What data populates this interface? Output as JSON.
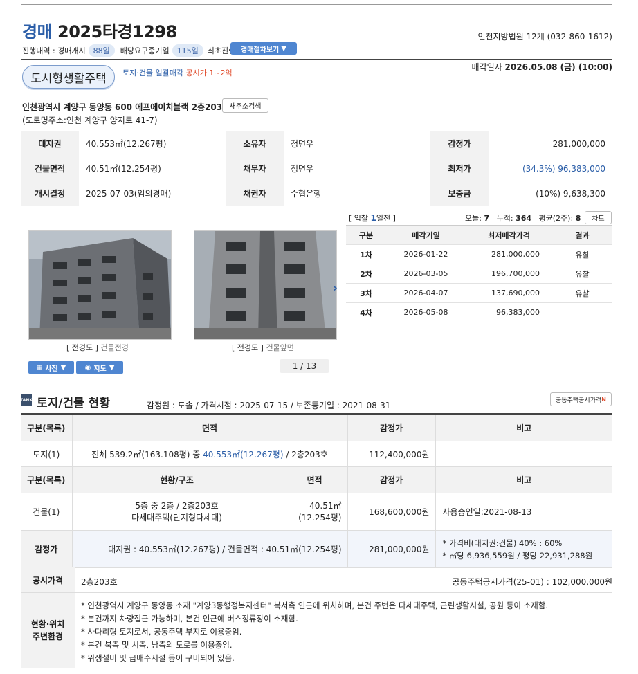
{
  "header": {
    "title_type": "경매",
    "case_no": "2025타경1298",
    "court": "인천지방법원 12계 (032-860-1612)",
    "progress_label": "진행내역 : 경매개시",
    "days_since_start": "88일",
    "dividend_label": "배당요구종기일",
    "dividend_days": "115일",
    "status": "최초진행",
    "procedure_button": "경매절차보기",
    "sale_date_label": "매각일자",
    "sale_date": "2026.05.08 (금) (10:00)"
  },
  "property": {
    "type": "도시형생활주택",
    "sale_kind": "토지·건물 일괄매각",
    "price_range": "공시가 1~2억",
    "address": "인천광역시 계양구 동양동 600 에프에이치블랙 2층203호",
    "new_address_button": "새주소검색",
    "road_address": "(도로명주소:인천 계양구 양지로 41-7)"
  },
  "summary": {
    "land_area_label": "대지권",
    "land_area": "40.553㎡(12.267평)",
    "owner_label": "소유자",
    "owner": "정면우",
    "appraisal_label": "감정가",
    "appraisal": "281,000,000",
    "building_area_label": "건물면적",
    "building_area": "40.51㎡(12.254평)",
    "debtor_label": "채무자",
    "debtor": "정면우",
    "min_price_label": "최저가",
    "min_price": "(34.3%) 96,383,000",
    "decision_label": "개시결정",
    "decision": "2025-07-03(임의경매)",
    "creditor_label": "채권자",
    "creditor": "수협은행",
    "deposit_label": "보증금",
    "deposit": "(10%) 9,638,300"
  },
  "photos": {
    "cap1_tag": "[ 전경도 ]",
    "cap1": "건물전경",
    "cap2_tag": "[ 전경도 ]",
    "cap2": "건물앞면",
    "photo_button": "사진",
    "map_button": "지도",
    "pager": "1 / 13"
  },
  "bids": {
    "head_prefix": "[ 입찰 ",
    "days": "1",
    "head_suffix": "일전 ]",
    "today_label": "오늘:",
    "today": "7",
    "total_label": "누적:",
    "total": "364",
    "avg_label": "평균(2주):",
    "avg": "8",
    "chart_button": "차트",
    "columns": [
      "구분",
      "매각기일",
      "최저매각가격",
      "결과"
    ],
    "rows": [
      {
        "round": "1차",
        "date": "2026-01-22",
        "price": "281,000,000",
        "result": "유찰"
      },
      {
        "round": "2차",
        "date": "2026-03-05",
        "price": "196,700,000",
        "result": "유찰"
      },
      {
        "round": "3차",
        "date": "2026-04-07",
        "price": "137,690,000",
        "result": "유찰"
      },
      {
        "round": "4차",
        "date": "2026-05-08",
        "price": "96,383,000",
        "result": ""
      }
    ]
  },
  "status_section": {
    "icon_text": "TANK",
    "title": "토지/건물 현황",
    "meta": "감정원 : 도솔 / 가격시점 : 2025-07-15 / 보존등기일 : 2021-08-31",
    "public_price_button": "공동주택공시가격",
    "new_mark": "N",
    "land_head": [
      "구분(목록)",
      "면적",
      "감정가",
      "비고"
    ],
    "land_row": {
      "kind": "토지(1)",
      "area_prefix": "전체 539.2㎡(163.108평) 중 ",
      "area_highlight": "40.553㎡(12.267평)",
      "area_suffix": " / 2층203호",
      "price": "112,400,000원",
      "note": ""
    },
    "bldg_head": [
      "구분(목록)",
      "현황/구조",
      "면적",
      "감정가",
      "비고"
    ],
    "bldg_row": {
      "kind": "건물(1)",
      "structure1": "5층 중 2층 / 2층203호",
      "structure2": "다세대주택(단지형다세대)",
      "area1": "40.51㎡",
      "area2": "(12.254평)",
      "price": "168,600,000원",
      "note": "사용승인일:2021-08-13"
    },
    "appraisal_row": {
      "label": "감정가",
      "areas": "대지권 : 40.553㎡(12.267평) / 건물면적 : 40.51㎡(12.254평)",
      "price": "281,000,000원",
      "note1": "* 가격비(대지권:건물) 40% : 60%",
      "note2": "* ㎡당 6,936,559원 / 평당 22,931,288원"
    },
    "public_label": "공시가격",
    "public_unit": "2층203호",
    "public_price": "공동주택공시가격(25-01) : 102,000,000원",
    "env_label1": "현황·위치",
    "env_label2": "주변환경",
    "env_items": [
      "* 인천광역시 계양구 동양동 소재 \"계양3동행정복지센터\" 북서측 인근에 위치하며, 본건 주변은 다세대주택, 근린생활시설, 공원 등이 소재함.",
      "* 본건까지 차량접근 가능하며, 본건 인근에 버스정류장이 소재함.",
      "* 사다리형 토지로서, 공동주택 부지로 이용중임.",
      "* 본건 북측 및 서측, 남측의 도로를 이용중임.",
      "* 위생설비 및 급배수시설 등이 구비되어 있음."
    ]
  }
}
